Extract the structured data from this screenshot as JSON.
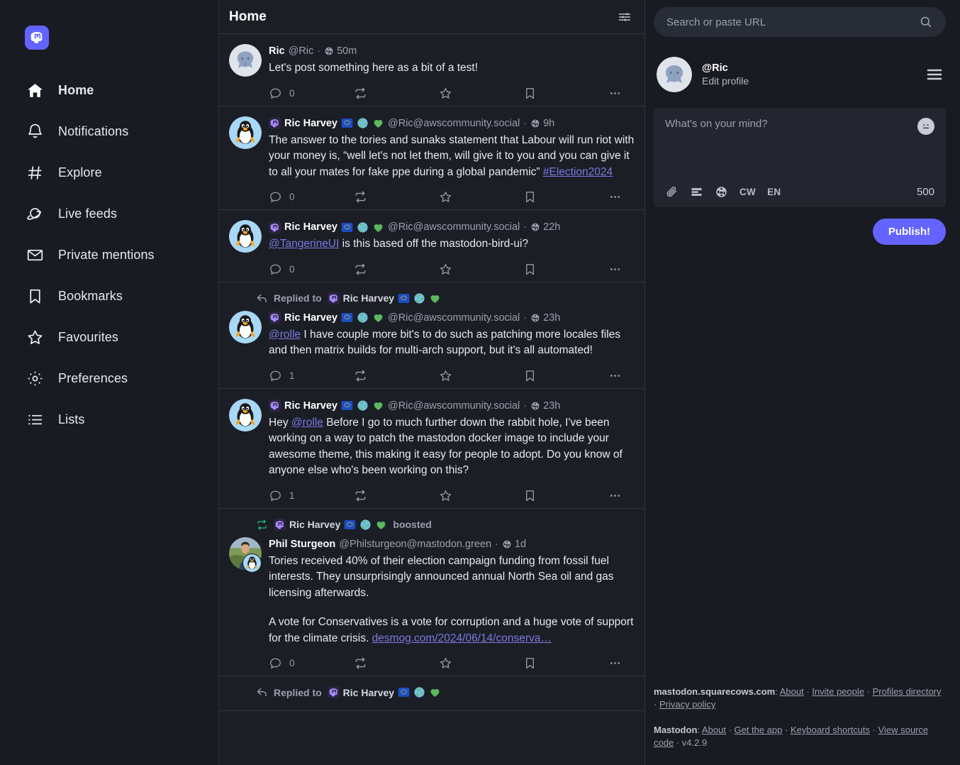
{
  "brand": {
    "logo_icon": "mastodon-logo-icon",
    "accent": "#6364ff",
    "boost_green": "#26ba7a",
    "link": "#7a7ae0"
  },
  "sidebar": {
    "items": [
      {
        "label": "Home",
        "icon": "home-icon",
        "active": true
      },
      {
        "label": "Notifications",
        "icon": "bell-icon",
        "active": false
      },
      {
        "label": "Explore",
        "icon": "hashtag-icon",
        "active": false
      },
      {
        "label": "Live feeds",
        "icon": "planet-icon",
        "active": false
      },
      {
        "label": "Private mentions",
        "icon": "envelope-icon",
        "active": false
      },
      {
        "label": "Bookmarks",
        "icon": "bookmark-icon",
        "active": false
      },
      {
        "label": "Favourites",
        "icon": "star-icon",
        "active": false
      },
      {
        "label": "Preferences",
        "icon": "gear-icon",
        "active": false
      },
      {
        "label": "Lists",
        "icon": "list-icon",
        "active": false
      }
    ]
  },
  "column": {
    "title": "Home",
    "settings_icon": "sliders-icon"
  },
  "statuses": [
    {
      "avatar": "elephant-avatar",
      "display_name": "Ric",
      "handle": "@Ric",
      "separator": "·",
      "time": "50m",
      "visibility_icon": "globe-icon",
      "badges": [],
      "paragraphs": [
        {
          "runs": [
            {
              "text": "Let's post something here as a bit of a test!",
              "type": "text"
            }
          ]
        }
      ],
      "actions": {
        "reply_count": "0",
        "reply_icon": "reply-bubble-icon",
        "boost_icon": "boost-icon",
        "favourite_icon": "star-outline-icon",
        "bookmark_icon": "bookmark-outline-icon",
        "more_icon": "ellipsis-icon"
      }
    },
    {
      "avatar": "tux-avatar",
      "display_name": "Ric Harvey",
      "handle": "@Ric@awscommunity.social",
      "separator": "·",
      "time": "9h",
      "visibility_icon": "globe-icon",
      "name_prefix_icon": "mastodon-emoji-icon",
      "badges": [
        "eu-flag-emoji",
        "earth-emoji",
        "green-heart-emoji"
      ],
      "paragraphs": [
        {
          "runs": [
            {
              "text": "The answer to the tories and sunaks statement that Labour will run riot with your money is, “well let's not let them, will give it to you and you can give it to all your mates for fake ppe during a global pandemic” ",
              "type": "text"
            },
            {
              "text": "#Election2024",
              "type": "link"
            }
          ]
        }
      ],
      "actions": {
        "reply_count": "0",
        "reply_icon": "reply-bubble-icon",
        "boost_icon": "boost-icon",
        "favourite_icon": "star-outline-icon",
        "bookmark_icon": "bookmark-outline-icon",
        "more_icon": "ellipsis-icon"
      }
    },
    {
      "avatar": "tux-avatar",
      "display_name": "Ric Harvey",
      "handle": "@Ric@awscommunity.social",
      "separator": "·",
      "time": "22h",
      "visibility_icon": "globe-icon",
      "name_prefix_icon": "mastodon-emoji-icon",
      "badges": [
        "eu-flag-emoji",
        "earth-emoji",
        "green-heart-emoji"
      ],
      "paragraphs": [
        {
          "runs": [
            {
              "text": "@TangerineUI",
              "type": "link"
            },
            {
              "text": " is this based off the mastodon-bird-ui?",
              "type": "text"
            }
          ]
        }
      ],
      "actions": {
        "reply_count": "0",
        "reply_icon": "reply-bubble-icon",
        "boost_icon": "boost-icon",
        "favourite_icon": "star-outline-icon",
        "bookmark_icon": "bookmark-outline-icon",
        "more_icon": "ellipsis-icon"
      }
    },
    {
      "prelude": {
        "type": "reply",
        "icon": "reply-arrow-icon",
        "text": "Replied to",
        "name": "Ric Harvey",
        "name_prefix_icon": "mastodon-emoji-icon",
        "badges": [
          "eu-flag-emoji",
          "earth-emoji",
          "green-heart-emoji"
        ]
      },
      "avatar": "tux-avatar",
      "display_name": "Ric Harvey",
      "handle": "@Ric@awscommunity.social",
      "separator": "·",
      "time": "23h",
      "visibility_icon": "globe-icon",
      "name_prefix_icon": "mastodon-emoji-icon",
      "badges": [
        "eu-flag-emoji",
        "earth-emoji",
        "green-heart-emoji"
      ],
      "paragraphs": [
        {
          "runs": [
            {
              "text": "@rolle",
              "type": "link"
            },
            {
              "text": " I have couple more bit's to do such as patching more locales files and then matrix builds for multi-arch support, but it's all automated!",
              "type": "text"
            }
          ]
        }
      ],
      "actions": {
        "reply_count": "1",
        "reply_icon": "reply-bubble-icon",
        "boost_icon": "boost-icon",
        "favourite_icon": "star-outline-icon",
        "bookmark_icon": "bookmark-outline-icon",
        "more_icon": "ellipsis-icon"
      }
    },
    {
      "avatar": "tux-avatar",
      "display_name": "Ric Harvey",
      "handle": "@Ric@awscommunity.social",
      "separator": "·",
      "time": "23h",
      "visibility_icon": "globe-icon",
      "name_prefix_icon": "mastodon-emoji-icon",
      "badges": [
        "eu-flag-emoji",
        "earth-emoji",
        "green-heart-emoji"
      ],
      "paragraphs": [
        {
          "runs": [
            {
              "text": "Hey ",
              "type": "text"
            },
            {
              "text": "@rolle",
              "type": "link"
            },
            {
              "text": " Before I go to much further down the rabbit hole, I've been working on a way to patch the mastodon docker image to include your awesome theme, this making it easy for people to adopt. Do you know of anyone else who's been working on this?",
              "type": "text"
            }
          ]
        }
      ],
      "actions": {
        "reply_count": "1",
        "reply_icon": "reply-bubble-icon",
        "boost_icon": "boost-icon",
        "favourite_icon": "star-outline-icon",
        "bookmark_icon": "bookmark-outline-icon",
        "more_icon": "ellipsis-icon"
      }
    },
    {
      "prelude": {
        "type": "boost",
        "icon": "boost-icon",
        "name": "Ric Harvey",
        "name_prefix_icon": "mastodon-emoji-icon",
        "badges": [
          "eu-flag-emoji",
          "earth-emoji",
          "green-heart-emoji"
        ],
        "text": "boosted"
      },
      "avatar": "photo-avatar",
      "avatar_badge": "tux-avatar",
      "display_name": "Phil Sturgeon",
      "handle": "@Philsturgeon@mastodon.green",
      "separator": "·",
      "time": "1d",
      "visibility_icon": "globe-icon",
      "badges": [],
      "paragraphs": [
        {
          "runs": [
            {
              "text": "Tories received 40% of their election campaign funding from fossil fuel interests. They unsurprisingly announced annual North Sea oil and gas licensing afterwards.",
              "type": "text"
            }
          ]
        },
        {
          "runs": [
            {
              "text": "A vote for Conservatives is a vote for corruption and a huge vote of support for the climate crisis. ",
              "type": "text"
            },
            {
              "text": "desmog.com/2024/06/14/conserva…",
              "type": "link"
            }
          ]
        }
      ],
      "actions": {
        "reply_count": "0",
        "reply_icon": "reply-bubble-icon",
        "boost_icon": "boost-icon",
        "favourite_icon": "star-outline-icon",
        "bookmark_icon": "bookmark-outline-icon",
        "more_icon": "ellipsis-icon"
      }
    },
    {
      "partial": true,
      "prelude": {
        "type": "reply",
        "icon": "reply-arrow-icon",
        "text": "Replied to",
        "name": "Ric Harvey",
        "name_prefix_icon": "mastodon-emoji-icon",
        "badges": [
          "eu-flag-emoji",
          "earth-emoji",
          "green-heart-emoji"
        ]
      }
    }
  ],
  "right": {
    "search": {
      "placeholder": "Search or paste URL",
      "value": "",
      "icon": "search-icon"
    },
    "account": {
      "avatar": "elephant-avatar",
      "handle": "@Ric",
      "edit_label": "Edit profile",
      "menu_icon": "hamburger-icon"
    },
    "composer": {
      "placeholder": "What's on your mind?",
      "value": "",
      "emoji_icon": "emoji-smiley-icon",
      "attach_icon": "paperclip-icon",
      "poll_icon": "poll-icon",
      "visibility_icon": "globe-icon",
      "cw_label": "CW",
      "lang_label": "EN",
      "char_count": "500",
      "publish_label": "Publish!"
    },
    "footer": {
      "instance_name": "mastodon.squarecows.com",
      "instance_links": [
        "About",
        "Invite people",
        "Profiles directory",
        "Privacy policy"
      ],
      "app_name": "Mastodon",
      "app_links": [
        "About",
        "Get the app",
        "Keyboard shortcuts",
        "View source code"
      ],
      "version": "v4.2.9",
      "separator": "·"
    }
  }
}
